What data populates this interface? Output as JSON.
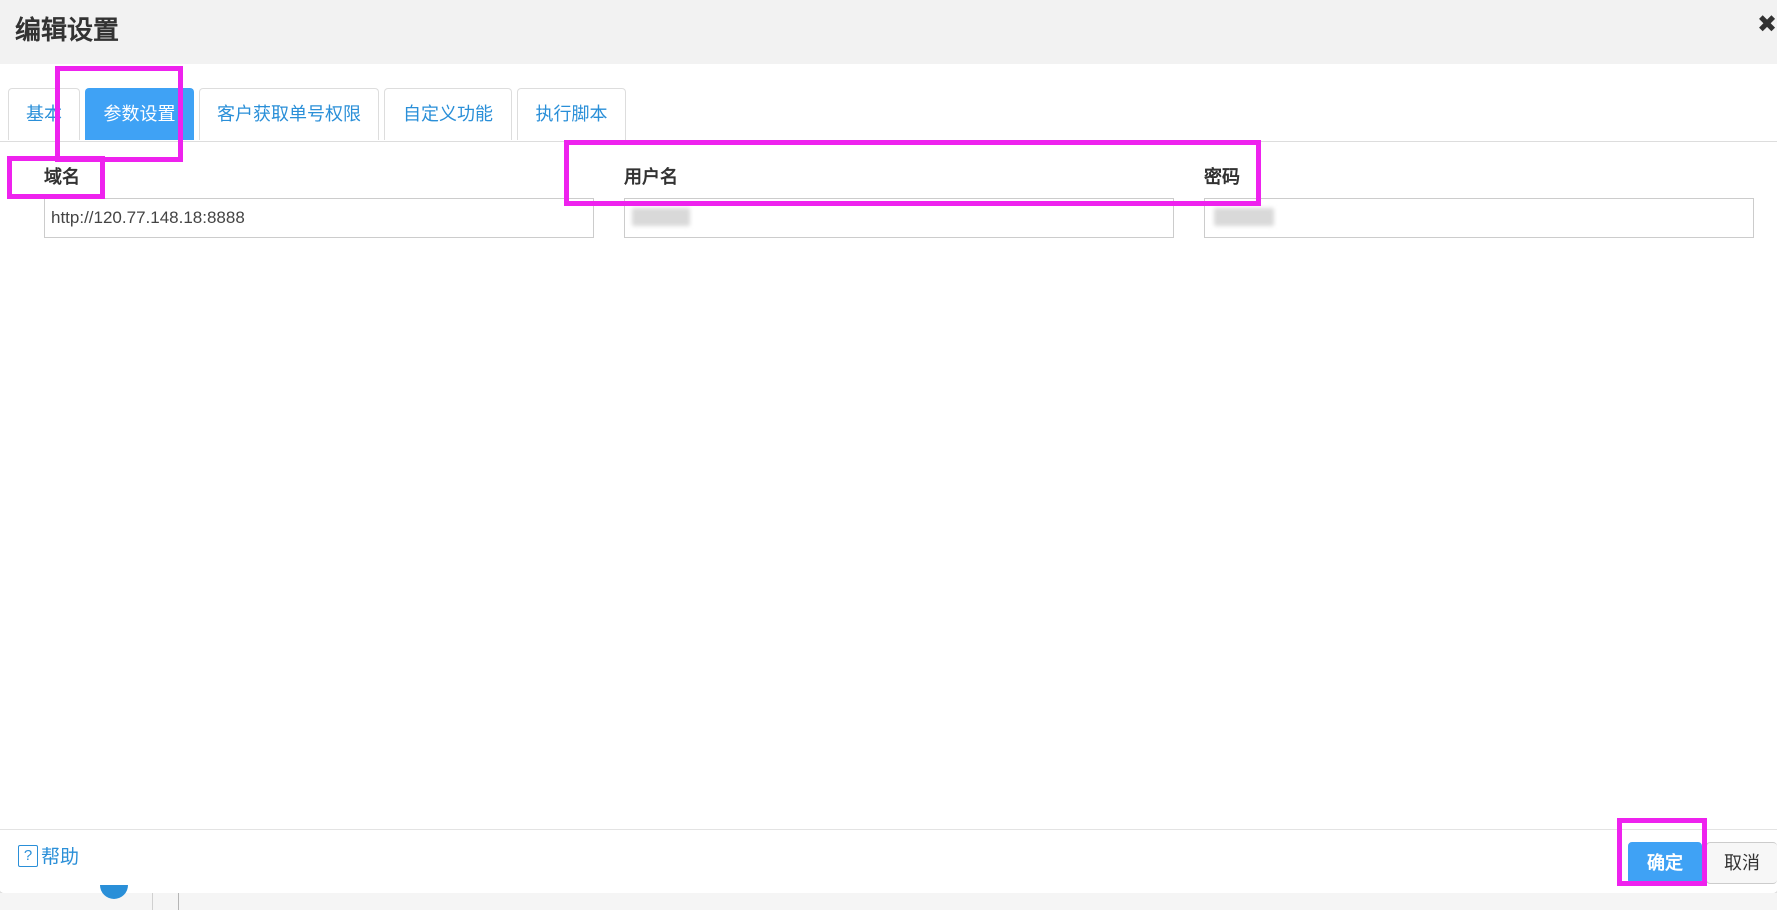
{
  "dialog": {
    "title": "编辑设置",
    "close_glyph": "✖"
  },
  "tabs": [
    {
      "label": "基本"
    },
    {
      "label": "参数设置",
      "active": true
    },
    {
      "label": "客户获取单号权限"
    },
    {
      "label": "自定义功能"
    },
    {
      "label": "执行脚本"
    }
  ],
  "form": {
    "domain_label": "域名",
    "domain_value": "http://120.77.148.18:8888",
    "username_label": "用户名",
    "password_label": "密码"
  },
  "footer": {
    "help_glyph": "?",
    "help_label": "帮助",
    "ok_label": "确定",
    "cancel_label": "取消"
  },
  "colors": {
    "accent": "#3fa2f5",
    "link": "#2a8fd8",
    "highlight": "#ee22ee",
    "header_bg": "#f2f2f2"
  }
}
